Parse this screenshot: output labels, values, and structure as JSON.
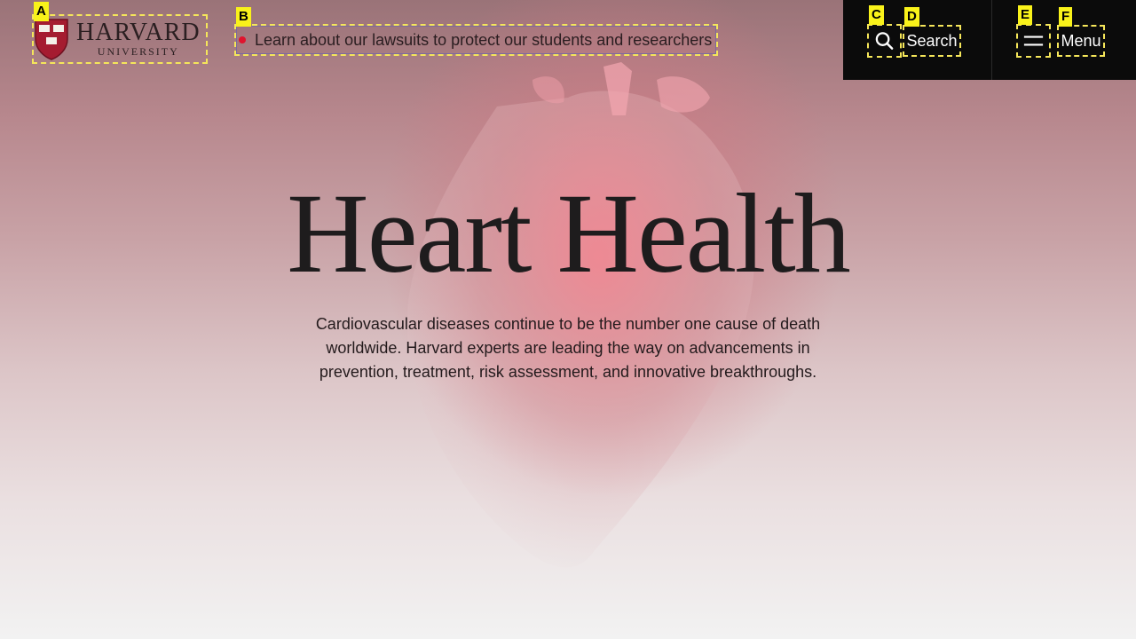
{
  "header": {
    "logo": {
      "name": "HARVARD",
      "sub": "UNIVERSITY"
    },
    "alert_link": "Learn about our lawsuits to protect our students and researchers",
    "search_label": "Search",
    "menu_label": "Menu",
    "search_icon": "search-icon",
    "menu_icon": "hamburger-icon"
  },
  "hero": {
    "title": "Heart Health",
    "description": "Cardiovascular diseases continue to be the number one cause of death worldwide. Harvard experts are leading the way on advancements in prevention, treatment, risk assessment, and innovative breakthroughs."
  },
  "markers": [
    "A",
    "B",
    "C",
    "D",
    "E",
    "F"
  ],
  "colors": {
    "accent_red": "#e0142e",
    "nav_bg": "#0b0b0b",
    "crimson": "#a51c30"
  }
}
